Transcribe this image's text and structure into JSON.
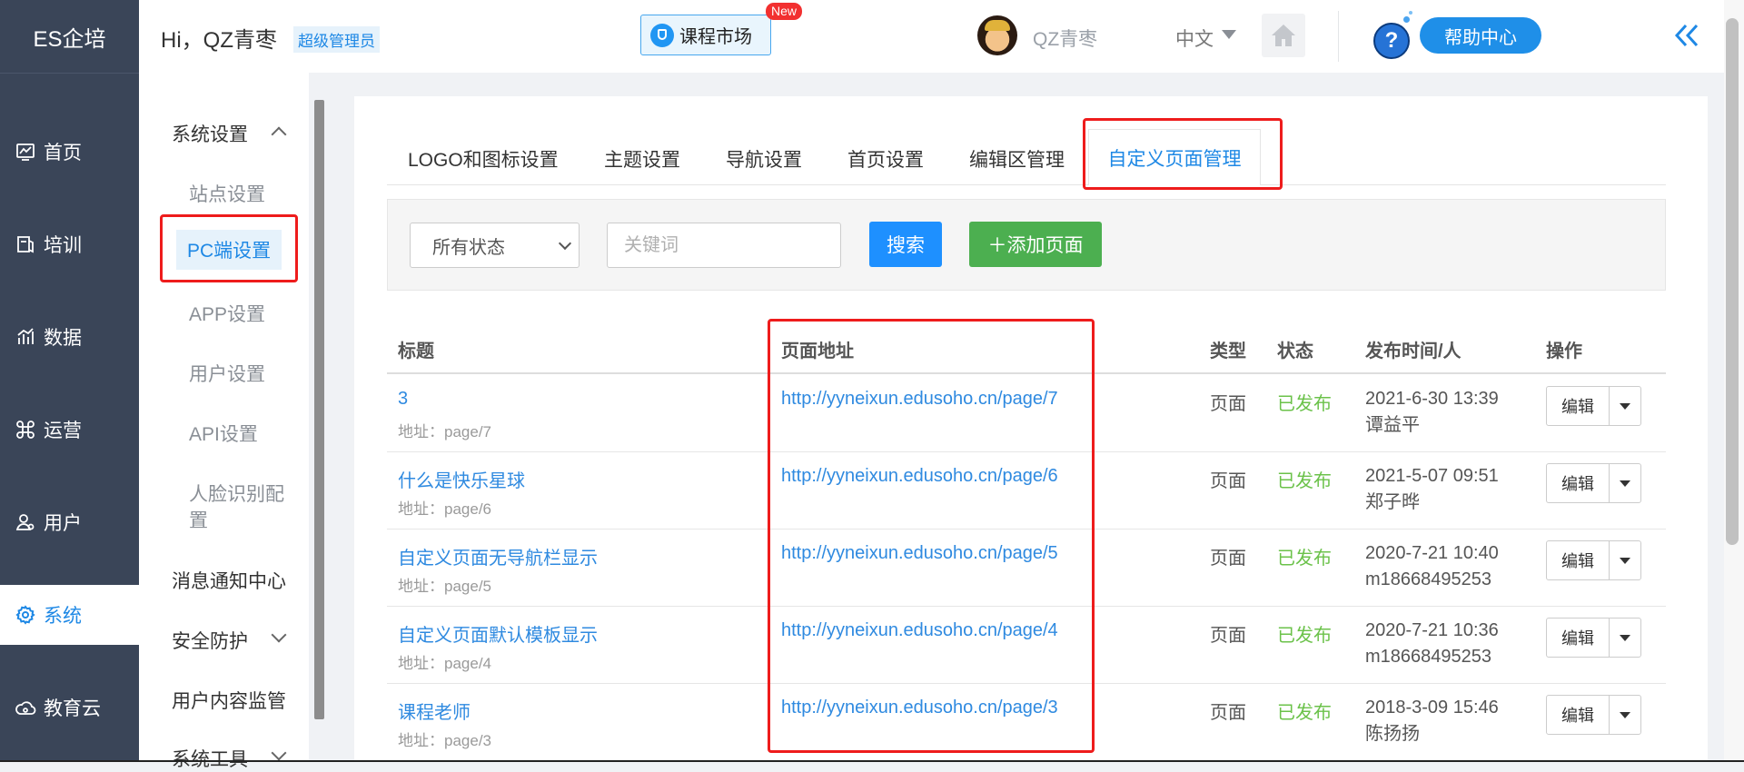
{
  "brand": "ES企培",
  "main_nav": [
    {
      "label": "首页",
      "icon": "dashboard-icon"
    },
    {
      "label": "培训",
      "icon": "training-icon"
    },
    {
      "label": "数据",
      "icon": "chart-icon"
    },
    {
      "label": "运营",
      "icon": "command-icon"
    },
    {
      "label": "用户",
      "icon": "user-icon"
    },
    {
      "label": "系统",
      "icon": "gear-icon",
      "active": true
    },
    {
      "label": "教育云",
      "icon": "cloud-icon"
    }
  ],
  "header": {
    "greeting": "Hi，QZ青枣",
    "role": "超级管理员",
    "course_market": "课程市场",
    "new_badge": "New",
    "username": "QZ青枣",
    "language": "中文",
    "help_center": "帮助中心",
    "help_symbol": "?"
  },
  "sub_nav": {
    "system_settings": "系统设置",
    "items": [
      "站点设置",
      "PC端设置",
      "APP设置",
      "用户设置",
      "API设置",
      "人脸识别配置"
    ],
    "face_line1": "人脸识别配",
    "face_line2": "置",
    "message_center": "消息通知中心",
    "security": "安全防护",
    "content_monitor": "用户内容监管",
    "system_tools": "系统工具"
  },
  "tabs": [
    "LOGO和图标设置",
    "主题设置",
    "导航设置",
    "首页设置",
    "编辑区管理",
    "自定义页面管理"
  ],
  "filter": {
    "status_selected": "所有状态",
    "keyword_placeholder": "关键词",
    "search": "搜索",
    "add_page": "＋添加页面"
  },
  "table": {
    "headers": [
      "标题",
      "页面地址",
      "类型",
      "状态",
      "发布时间/人",
      "操作"
    ],
    "rows": [
      {
        "title": "3",
        "addr": "地址：page/7",
        "url": "http://yyneixun.edusoho.cn/page/7",
        "type": "页面",
        "status": "已发布",
        "time": "2021-6-30 13:39",
        "person": "谭益平",
        "edit": "编辑"
      },
      {
        "title": "什么是快乐星球",
        "addr": "地址：page/6",
        "url": "http://yyneixun.edusoho.cn/page/6",
        "type": "页面",
        "status": "已发布",
        "time": "2021-5-07 09:51",
        "person": "郑子晔",
        "edit": "编辑"
      },
      {
        "title": "自定义页面无导航栏显示",
        "addr": "地址：page/5",
        "url": "http://yyneixun.edusoho.cn/page/5",
        "type": "页面",
        "status": "已发布",
        "time": "2020-7-21 10:40",
        "person": "m18668495253",
        "edit": "编辑"
      },
      {
        "title": "自定义页面默认模板显示",
        "addr": "地址：page/4",
        "url": "http://yyneixun.edusoho.cn/page/4",
        "type": "页面",
        "status": "已发布",
        "time": "2020-7-21 10:36",
        "person": "m18668495253",
        "edit": "编辑"
      },
      {
        "title": "课程老师",
        "addr": "地址：page/3",
        "url": "http://yyneixun.edusoho.cn/page/3",
        "type": "页面",
        "status": "已发布",
        "time": "2018-3-09 15:46",
        "person": "陈扬扬",
        "edit": "编辑"
      }
    ]
  },
  "colors": {
    "nav_bg": "#3a4558",
    "accent": "#1e88e5",
    "success": "#4caf50",
    "published": "#6bc24a",
    "annotation": "#ee1c1c"
  }
}
